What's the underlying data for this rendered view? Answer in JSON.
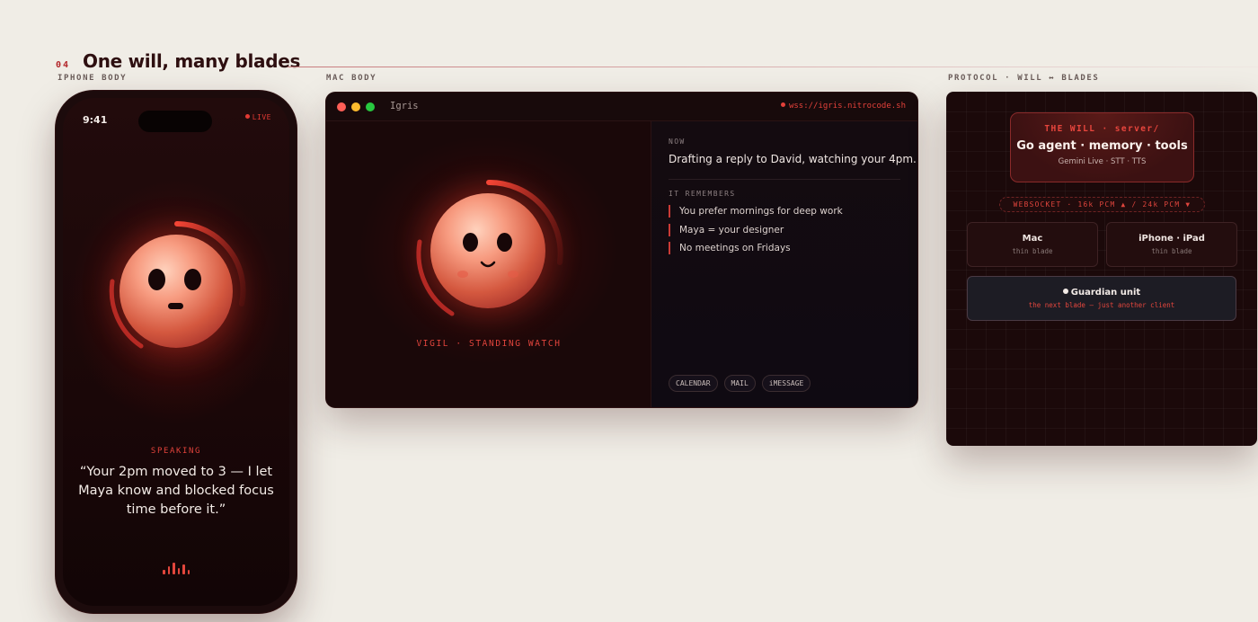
{
  "section": {
    "number": "04",
    "title": "One will, many blades"
  },
  "labels": {
    "iphone": "IPHONE BODY",
    "mac": "MAC BODY",
    "protocol": "PROTOCOL · WILL ↔ BLADES"
  },
  "phone": {
    "time": "9:41",
    "status": "LIVE",
    "state_label": "SPEAKING",
    "quote": "“Your 2pm moved to 3 — I let Maya know and blocked focus time before it.”"
  },
  "mac": {
    "window_title": "Igris",
    "connection_url": "wss://igris.nitrocode.sh",
    "status_label": "VIGIL · STANDING WATCH",
    "now_label": "NOW",
    "now_text": "Drafting a reply to David, watching your 4pm.",
    "remembers_label": "IT REMEMBERS",
    "memories": [
      "You prefer mornings for deep work",
      "Maya = your designer",
      "No meetings on Fridays"
    ],
    "integrations": [
      "CALENDAR",
      "MAIL",
      "iMESSAGE"
    ]
  },
  "protocol": {
    "will": {
      "label": "THE WILL · server/",
      "title": "Go agent · memory · tools",
      "subtitle": "Gemini Live · STT · TTS"
    },
    "transport": "WEBSOCKET · 16k PCM ▲ / 24k PCM ▼",
    "blades": [
      {
        "name": "Mac",
        "sub": "thin blade"
      },
      {
        "name": "iPhone · iPad",
        "sub": "thin blade"
      }
    ],
    "guardian": {
      "name": "Guardian unit",
      "sub": "the next blade — just another client"
    }
  },
  "colors": {
    "accent": "#e3413a",
    "page_bg": "#f0ede6",
    "panel_bg": "#1b090a",
    "traffic_red": "#ff5f57",
    "traffic_yellow": "#febc2e",
    "traffic_green": "#28c840"
  },
  "icons": {
    "live_dot": "dot-icon",
    "voice_wave": "waveform-icon"
  }
}
